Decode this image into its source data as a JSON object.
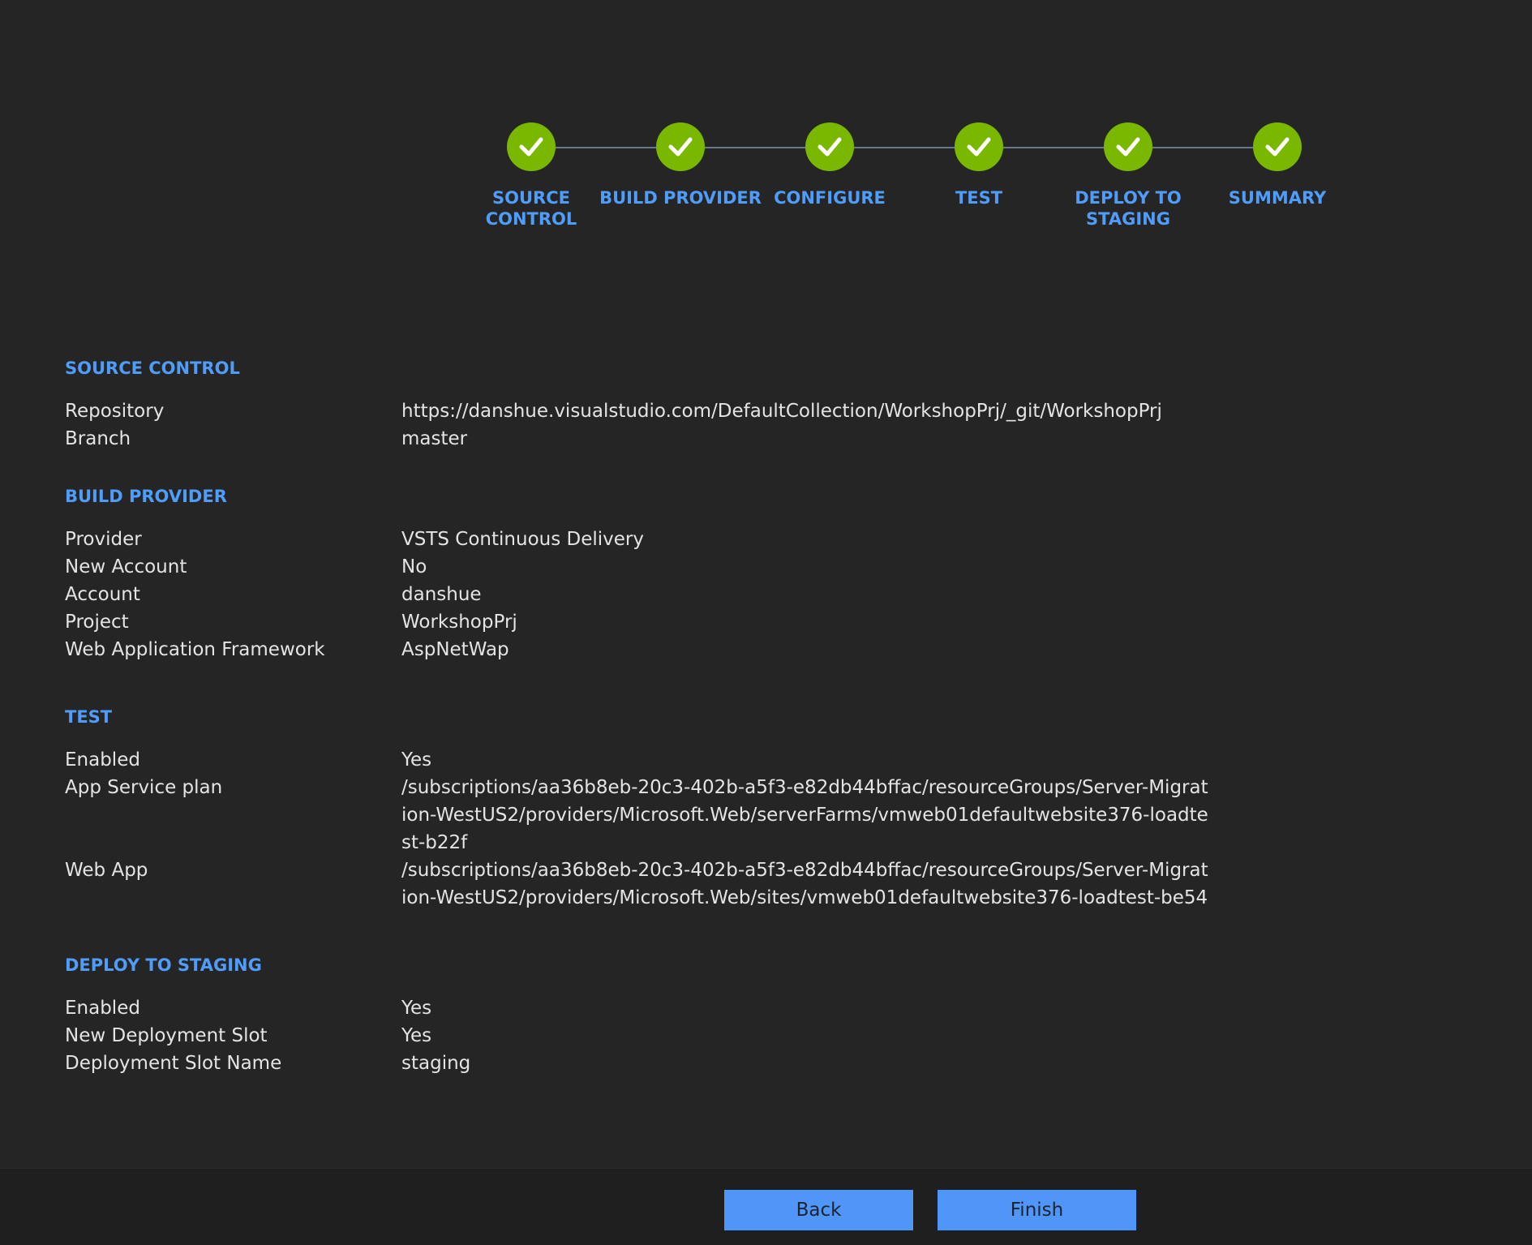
{
  "wizard": {
    "steps": [
      {
        "label": "SOURCE\nCONTROL",
        "status": "complete",
        "icon": "checkmark-icon"
      },
      {
        "label": "BUILD PROVIDER",
        "status": "complete",
        "icon": "checkmark-icon"
      },
      {
        "label": "CONFIGURE",
        "status": "complete",
        "icon": "checkmark-icon"
      },
      {
        "label": "TEST",
        "status": "complete",
        "icon": "checkmark-icon"
      },
      {
        "label": "DEPLOY TO\nSTAGING",
        "status": "complete",
        "icon": "checkmark-icon"
      },
      {
        "label": "SUMMARY",
        "status": "complete",
        "icon": "checkmark-icon"
      }
    ],
    "complete_color": "#7ab800",
    "accent_color": "#4f9cf9"
  },
  "summary": {
    "sections": [
      {
        "title": "SOURCE CONTROL",
        "rows": [
          {
            "key": "Repository",
            "value": "https://danshue.visualstudio.com/DefaultCollection/WorkshopPrj/_git/WorkshopPrj"
          },
          {
            "key": "Branch",
            "value": "master"
          }
        ]
      },
      {
        "title": "BUILD PROVIDER",
        "rows": [
          {
            "key": "Provider",
            "value": "VSTS Continuous Delivery"
          },
          {
            "key": "New Account",
            "value": "No"
          },
          {
            "key": "Account",
            "value": "danshue"
          },
          {
            "key": "Project",
            "value": "WorkshopPrj"
          },
          {
            "key": "Web Application Framework",
            "value": "AspNetWap"
          }
        ]
      },
      {
        "title": "TEST",
        "rows": [
          {
            "key": "Enabled",
            "value": "Yes"
          },
          {
            "key": "App Service plan",
            "value": "/subscriptions/aa36b8eb-20c3-402b-a5f3-e82db44bffac/resourceGroups/Server-Migration-WestUS2/providers/Microsoft.Web/serverFarms/vmweb01defaultwebsite376-loadtest-b22f"
          },
          {
            "key": "Web App",
            "value": "/subscriptions/aa36b8eb-20c3-402b-a5f3-e82db44bffac/resourceGroups/Server-Migration-WestUS2/providers/Microsoft.Web/sites/vmweb01defaultwebsite376-loadtest-be54"
          }
        ]
      },
      {
        "title": "DEPLOY TO STAGING",
        "rows": [
          {
            "key": "Enabled",
            "value": "Yes"
          },
          {
            "key": "New Deployment Slot",
            "value": "Yes"
          },
          {
            "key": "Deployment Slot Name",
            "value": "staging"
          }
        ]
      }
    ]
  },
  "footer": {
    "back_label": "Back",
    "finish_label": "Finish",
    "button_color": "#4f96f8"
  }
}
